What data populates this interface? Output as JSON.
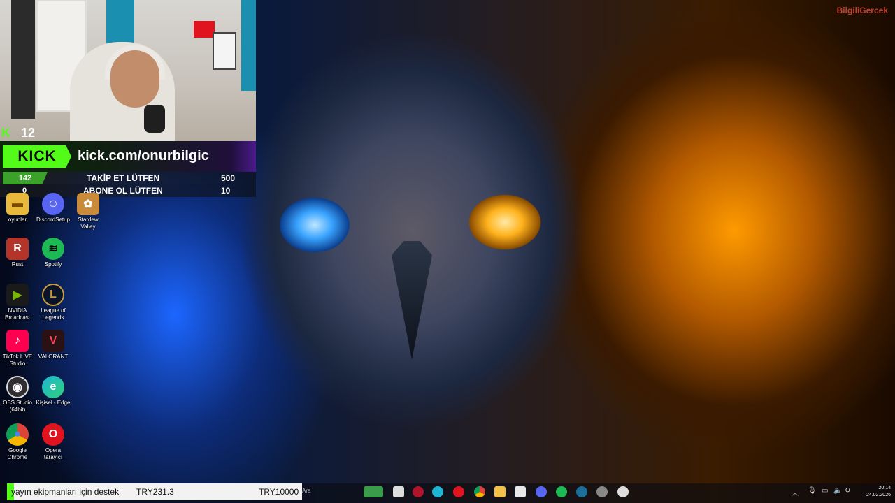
{
  "watermark": "BilgiliGercek",
  "webcam": {
    "kick_followers_count": "12"
  },
  "banner": {
    "logo": "KICK",
    "url": "kick.com/onurbilgic"
  },
  "goals": [
    {
      "current": "142",
      "label": "TAKİP ET LÜTFEN",
      "target": "500"
    },
    {
      "current": "0",
      "label": "ABONE OL LÜTFEN",
      "target": "10"
    }
  ],
  "desktop_icons": [
    {
      "label": "oyunlar",
      "icon": "folder-icon",
      "color": "#e8b93a"
    },
    {
      "label": "DiscordSetup",
      "icon": "discord-icon",
      "color": "#5865f2"
    },
    {
      "label": "Stardew Valley",
      "icon": "stardew-icon",
      "color": "#c98a3a"
    },
    {
      "label": "Rust",
      "icon": "rust-icon",
      "color": "#b3352a"
    },
    {
      "label": "Spotify",
      "icon": "spotify-icon",
      "color": "#1db954"
    },
    {
      "label": "NVIDIA Broadcast",
      "icon": "nvidia-icon",
      "color": "#76b900"
    },
    {
      "label": "League of Legends",
      "icon": "league-icon",
      "color": "#c89b3c"
    },
    {
      "label": "TikTok LIVE Studio",
      "icon": "tiktok-icon",
      "color": "#ff0050"
    },
    {
      "label": "VALORANT",
      "icon": "valorant-icon",
      "color": "#ff4655"
    },
    {
      "label": "OBS Studio (64bit)",
      "icon": "obs-icon",
      "color": "#302e31"
    },
    {
      "label": "Kişisel - Edge",
      "icon": "edge-icon",
      "color": "#1fb6d6"
    },
    {
      "label": "Google Chrome",
      "icon": "chrome-icon",
      "color": "#db4437"
    },
    {
      "label": "Opera tarayıcı",
      "icon": "opera-icon",
      "color": "#e0141e"
    }
  ],
  "donation": {
    "text": "yayın ekipmanları için destek",
    "current": "TRY231.3",
    "target": "TRY10000",
    "progress": 0.023
  },
  "taskbar": {
    "search_placeholder": "Ara",
    "apps": [
      {
        "name": "weather-widget",
        "color": "#3a9b4a"
      },
      {
        "name": "file-icon",
        "color": "#dcdcdc"
      },
      {
        "name": "opera-gx-icon",
        "color": "#b0142a"
      },
      {
        "name": "edge-icon",
        "color": "#1fb6d6"
      },
      {
        "name": "opera-icon",
        "color": "#e0141e"
      },
      {
        "name": "chrome-icon",
        "color": "#db4437"
      },
      {
        "name": "file-explorer-icon",
        "color": "#f2c14a"
      },
      {
        "name": "store-icon",
        "color": "#e8e8e8"
      },
      {
        "name": "discord-icon",
        "color": "#5865f2"
      },
      {
        "name": "spotify-icon",
        "color": "#1db954"
      },
      {
        "name": "steam-icon",
        "color": "#1b6f9a"
      },
      {
        "name": "steelseries-icon",
        "color": "#888888"
      },
      {
        "name": "settings-icon",
        "color": "#dddddd"
      }
    ],
    "time": "20:14",
    "date": "24.02.2026"
  }
}
